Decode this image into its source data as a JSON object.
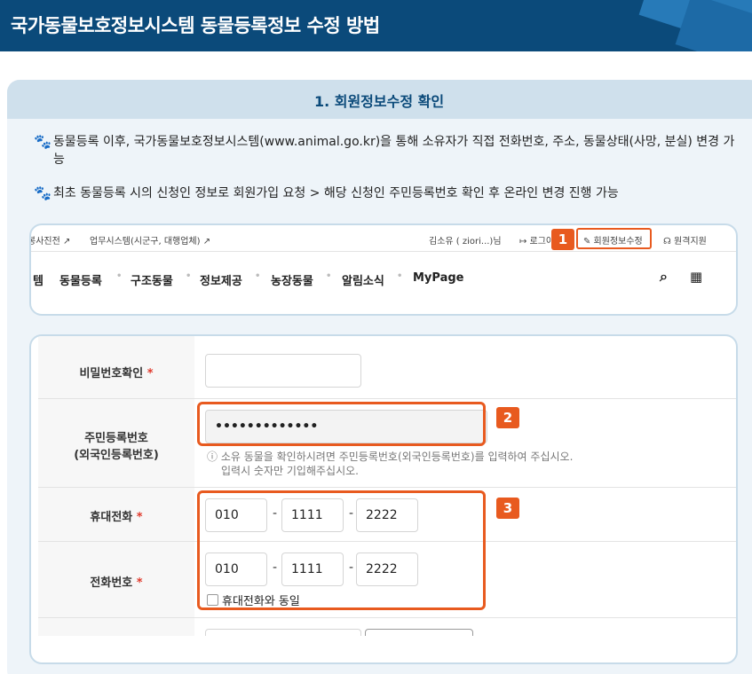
{
  "header": {
    "title": "국가동물보호정보시스템 동물등록정보 수정 방법"
  },
  "section": {
    "title": "1. 회원정보수정 확인"
  },
  "bullets": [
    "동물등록 이후, 국가동물보호정보시스템(www.animal.go.kr)을 통해 소유자가 직접 전화번호, 주소, 동물상태(사망, 분실) 변경 가능",
    "최초 동물등록 시의 신청인 정보로 회원가입 요청 > 해당 신청인 주민등록번호 확인 후 온라인 변경 진행 가능"
  ],
  "topbar": {
    "link1": "봉사진전 ↗",
    "link2": "업무시스템(시군구, 대행업체) ↗",
    "user": "김소유 ( ziori...)님",
    "logout": "↦ 로그아",
    "edit": "✎ 회원정보수정",
    "support": "☊ 원격지원"
  },
  "nav": {
    "partial": "템",
    "items": [
      "동물등록",
      "구조동물",
      "정보제공",
      "농장동물",
      "알림소식",
      "MyPage"
    ],
    "search_icon": "⌕",
    "menu_icon": "▦"
  },
  "form": {
    "pw_confirm_label": "비밀번호확인",
    "rrn_label_1": "주민등록번호",
    "rrn_label_2": "(외국인등록번호)",
    "rrn_value": "•••••••••••••",
    "rrn_help_1": "ⓘ 소유 동물을 확인하시려면 주민등록번호(외국인등록번호)를 입력하여 주십시오.",
    "rrn_help_2": "입력시 숫자만 기입해주십시오.",
    "mobile_label": "휴대전화",
    "mobile": [
      "010",
      "1111",
      "2222"
    ],
    "phone_label": "전화번호",
    "phone": [
      "010",
      "1111",
      "2222"
    ],
    "same_label": "휴대전화와 동일",
    "required_mark": "*",
    "dash": "-"
  },
  "badges": [
    "1",
    "2",
    "3"
  ],
  "colors": {
    "header_bg": "#0b4a7a",
    "accent": "#e85a1f",
    "paw": "#2b74b8"
  }
}
